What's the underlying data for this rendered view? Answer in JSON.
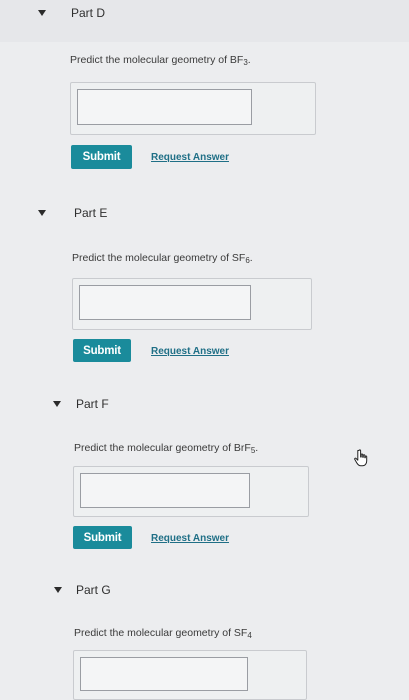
{
  "parts": [
    {
      "title": "Part D",
      "prompt_prefix": "Predict the molecular geometry of BF",
      "prompt_sub": "3",
      "prompt_suffix": ".",
      "input_value": "",
      "submit_label": "Submit",
      "request_label": "Request Answer"
    },
    {
      "title": "Part E",
      "prompt_prefix": "Predict the molecular geometry of SF",
      "prompt_sub": "6",
      "prompt_suffix": ".",
      "input_value": "",
      "submit_label": "Submit",
      "request_label": "Request Answer"
    },
    {
      "title": "Part F",
      "prompt_prefix": "Predict the molecular geometry of BrF",
      "prompt_sub": "5",
      "prompt_suffix": ".",
      "input_value": "",
      "submit_label": "Submit",
      "request_label": "Request Answer"
    },
    {
      "title": "Part G",
      "prompt_prefix": "Predict the molecular geometry of SF",
      "prompt_sub": "4",
      "prompt_suffix": "",
      "input_value": ""
    }
  ],
  "cursor_icon": "hand-pointer-icon"
}
